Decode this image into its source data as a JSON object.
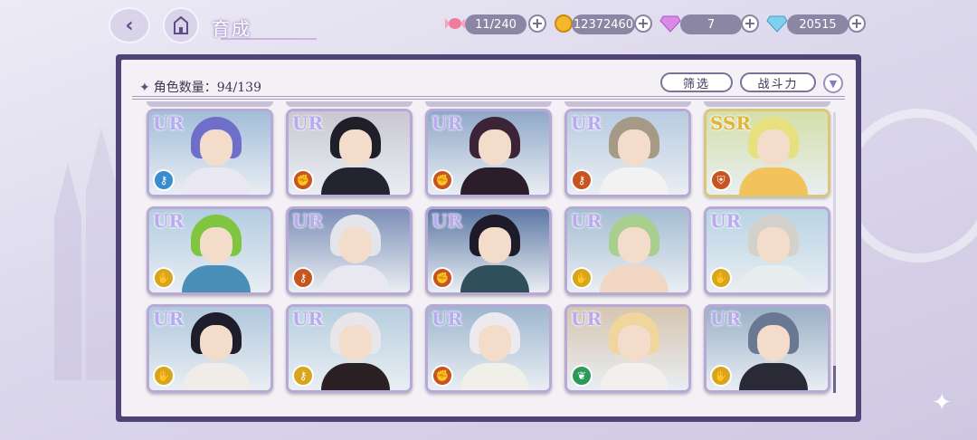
{
  "header": {
    "title": "育成",
    "back_icon": "back-arrow-icon",
    "home_icon": "castle-icon"
  },
  "resources": [
    {
      "name": "candy",
      "icon": "candy-icon",
      "value": "11/240"
    },
    {
      "name": "gold",
      "icon": "coin-icon",
      "value": "12372460"
    },
    {
      "name": "pink-gem",
      "icon": "pink-diamond-icon",
      "value": "7"
    },
    {
      "name": "blue-gem",
      "icon": "blue-diamond-icon",
      "value": "20515"
    }
  ],
  "panel": {
    "count_label": "角色数量：94/139",
    "filter_label": "筛选",
    "power_label": "战斗力",
    "sort_icon": "chevron-down-icon"
  },
  "cards": [
    {
      "rarity": "UR",
      "attr": "key-icon",
      "attr_color": "#3b8bd0",
      "hair": "#6f6fc9",
      "outfit": "#e9e7f2",
      "bg": "#a2bdd8"
    },
    {
      "rarity": "UR",
      "attr": "fist-icon",
      "attr_color": "#c8551f",
      "hair": "#1f1f2a",
      "outfit": "#242430",
      "bg": "#c9c7d1"
    },
    {
      "rarity": "UR",
      "attr": "fist-icon",
      "attr_color": "#c8551f",
      "hair": "#3a2436",
      "outfit": "#2b1e2a",
      "bg": "#8fa8c8"
    },
    {
      "rarity": "UR",
      "attr": "key-icon",
      "attr_color": "#c8551f",
      "hair": "#a49a86",
      "outfit": "#f2f2f2",
      "bg": "#b8cbe0"
    },
    {
      "rarity": "SSR",
      "attr": "shield-icon",
      "attr_color": "#c8551f",
      "hair": "#e6e07e",
      "outfit": "#f1c35a",
      "bg": "#d4dfa8"
    },
    {
      "rarity": "UR",
      "attr": "hand-icon",
      "attr_color": "#d9a51c",
      "hair": "#7fc540",
      "outfit": "#4a8fb8",
      "bg": "#b3cce0"
    },
    {
      "rarity": "UR",
      "attr": "key-icon",
      "attr_color": "#c8551f",
      "hair": "#e4e4ec",
      "outfit": "#e9e8f0",
      "bg": "#7d8fb8"
    },
    {
      "rarity": "UR",
      "attr": "fist-icon",
      "attr_color": "#c8551f",
      "hair": "#1d1b2a",
      "outfit": "#2f4f5a",
      "bg": "#5d78a4"
    },
    {
      "rarity": "UR",
      "attr": "hand-icon",
      "attr_color": "#d9a51c",
      "hair": "#a8cf8e",
      "outfit": "#f1d6c4",
      "bg": "#a5bdd2"
    },
    {
      "rarity": "UR",
      "attr": "hand-icon",
      "attr_color": "#d9a51c",
      "hair": "#d4d0cc",
      "outfit": "#e8eef0",
      "bg": "#b9d3e4"
    },
    {
      "rarity": "UR",
      "attr": "hand-icon",
      "attr_color": "#d9a51c",
      "hair": "#1f1d2c",
      "outfit": "#f0ece8",
      "bg": "#b0c8dc"
    },
    {
      "rarity": "UR",
      "attr": "key-icon",
      "attr_color": "#d9a51c",
      "hair": "#e8e6ea",
      "outfit": "#2b2124",
      "bg": "#b6cede"
    },
    {
      "rarity": "UR",
      "attr": "fist-icon",
      "attr_color": "#c8551f",
      "hair": "#eceaee",
      "outfit": "#f0efe8",
      "bg": "#9eb6cf"
    },
    {
      "rarity": "UR",
      "attr": "leaf-icon",
      "attr_color": "#2e9a5a",
      "hair": "#f0d59c",
      "outfit": "#f2f0ee",
      "bg": "#d6c5b0"
    },
    {
      "rarity": "UR",
      "attr": "hand-icon",
      "attr_color": "#d9a51c",
      "hair": "#6a7894",
      "outfit": "#2a2a36",
      "bg": "#9ab0c6"
    }
  ]
}
